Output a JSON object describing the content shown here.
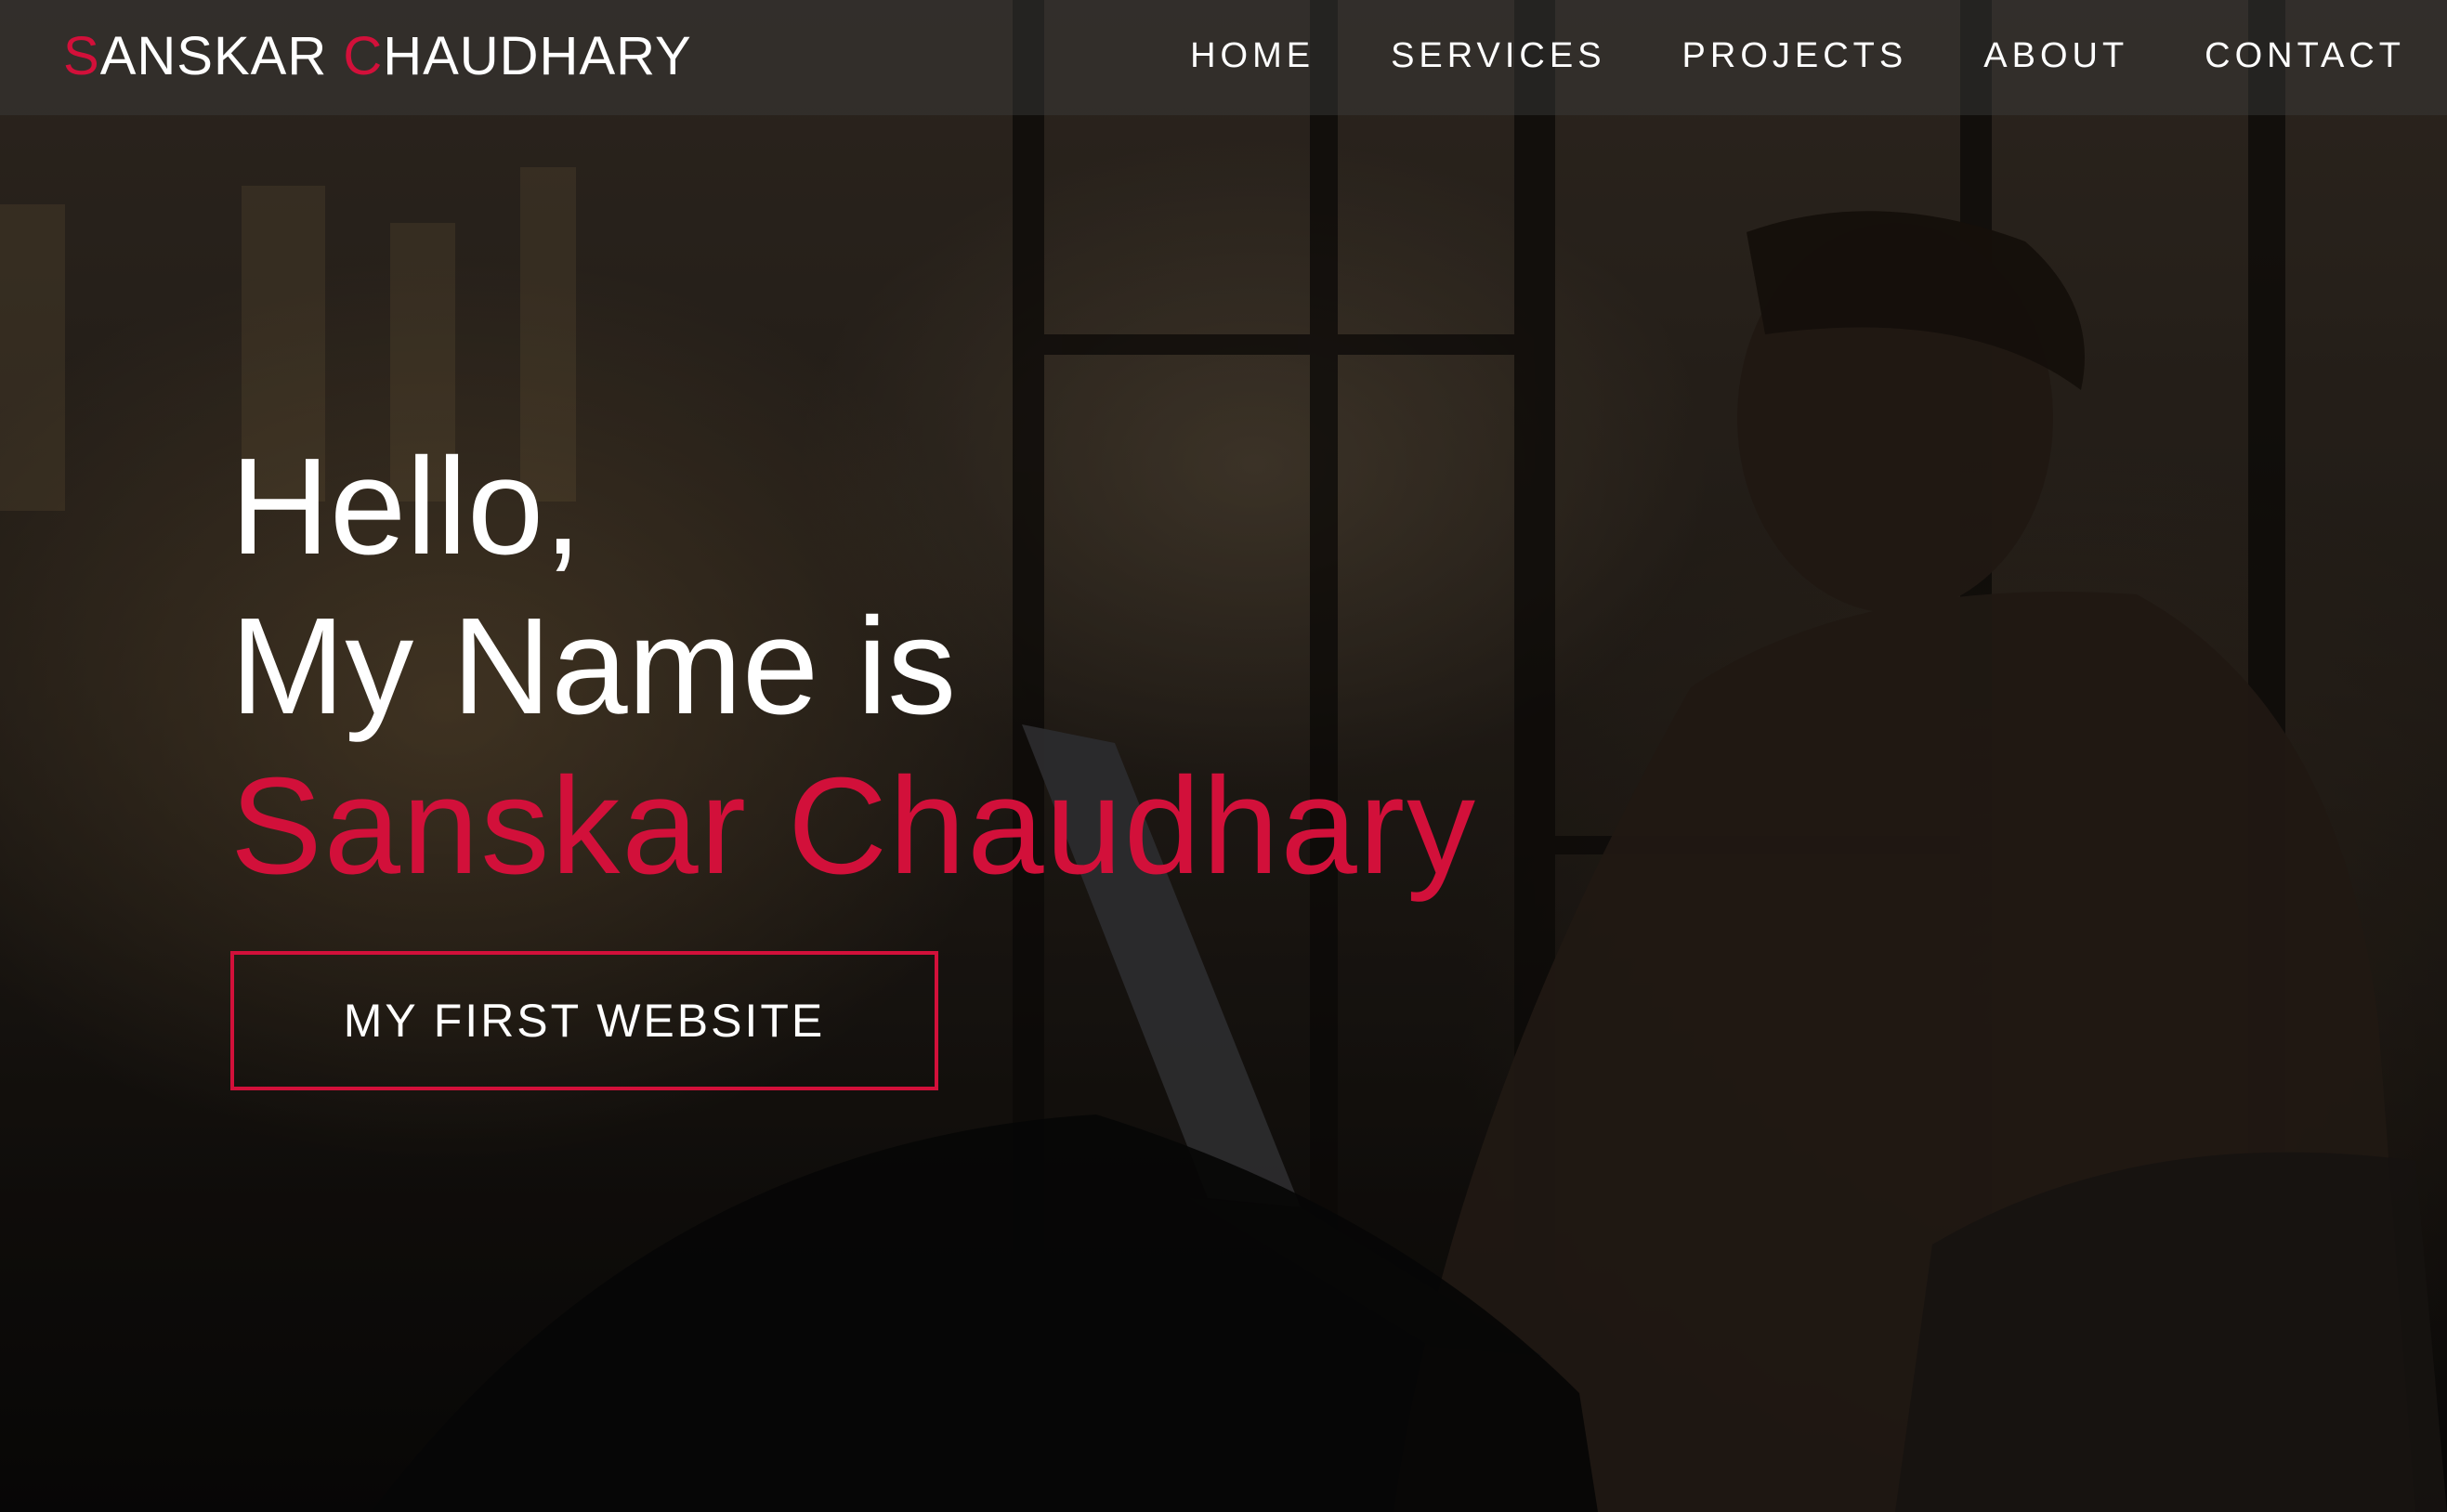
{
  "header": {
    "logo": {
      "first_initial": "S",
      "first_rest": "ANSKAR ",
      "last_initial": "C",
      "last_rest": "HAUDHARY"
    },
    "nav": [
      {
        "label": "HOME"
      },
      {
        "label": "SERVICES"
      },
      {
        "label": "PROJECTS"
      },
      {
        "label": "ABOUT"
      },
      {
        "label": "CONTACT"
      }
    ]
  },
  "hero": {
    "greeting": "Hello,",
    "intro": "My Name is",
    "name": "Sanskar Chaudhary",
    "cta_label": "MY FIRST WEBSITE"
  },
  "colors": {
    "accent": "#d2103a",
    "text": "#ffffff",
    "header_bg": "#3c3c3c"
  }
}
